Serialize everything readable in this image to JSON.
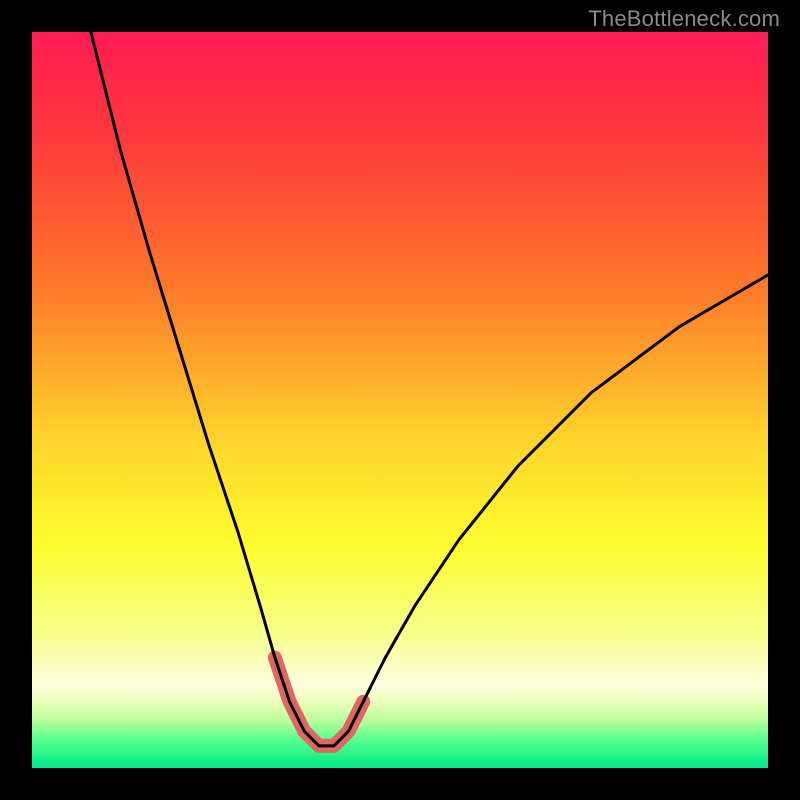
{
  "watermark": "TheBottleneck.com",
  "colors": {
    "frame": "#000000",
    "gradient_stops": [
      {
        "offset": 0.0,
        "color": "#ff1a53"
      },
      {
        "offset": 0.15,
        "color": "#ff3b3b"
      },
      {
        "offset": 0.35,
        "color": "#ff7a2a"
      },
      {
        "offset": 0.55,
        "color": "#ffd22b"
      },
      {
        "offset": 0.7,
        "color": "#ffff30"
      },
      {
        "offset": 0.82,
        "color": "#f6ff8c"
      },
      {
        "offset": 0.885,
        "color": "#ffffe0"
      },
      {
        "offset": 0.905,
        "color": "#f3ffc0"
      },
      {
        "offset": 0.935,
        "color": "#b8ff9c"
      },
      {
        "offset": 0.965,
        "color": "#4fff8c"
      },
      {
        "offset": 1.0,
        "color": "#00e88a"
      }
    ],
    "curve": "#000000",
    "highlight": "#e06666",
    "watermark_text": "#8a8a8a"
  },
  "chart_data": {
    "type": "line",
    "title": "",
    "xlabel": "",
    "ylabel": "",
    "xlim": [
      0,
      100
    ],
    "ylim": [
      0,
      100
    ],
    "grid": false,
    "series": [
      {
        "name": "bottleneck_curve",
        "x": [
          8,
          12,
          16,
          20,
          24,
          28,
          31,
          33,
          35,
          37,
          39,
          41,
          43,
          45,
          48,
          52,
          58,
          66,
          76,
          88,
          100
        ],
        "y": [
          100,
          84,
          70,
          57,
          44,
          32,
          22,
          15,
          9,
          5,
          3,
          3,
          5,
          9,
          15,
          22,
          31,
          41,
          51,
          60,
          67
        ]
      }
    ],
    "highlight_range": {
      "x_start": 33,
      "x_end": 46,
      "note": "valley emphasis band"
    }
  }
}
